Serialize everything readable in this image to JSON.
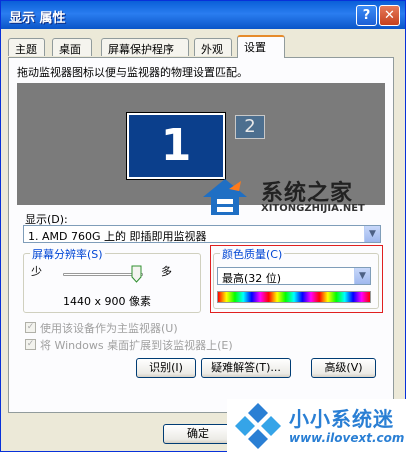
{
  "window": {
    "title": "显示 属性",
    "help_glyph": "?",
    "close_glyph": "✕"
  },
  "tabs": [
    {
      "label": "主题"
    },
    {
      "label": "桌面"
    },
    {
      "label": "屏幕保护程序"
    },
    {
      "label": "外观"
    },
    {
      "label": "设置",
      "active": true
    }
  ],
  "settings": {
    "instruction": "拖动监视器图标以便与监视器的物理设置匹配。",
    "monitor1": "1",
    "monitor2": "2",
    "display_label": "显示(D):",
    "display_value": "1. AMD 760G 上的 即插即用监视器",
    "resolution": {
      "title": "屏幕分辨率(S)",
      "less": "少",
      "more": "多",
      "value_text": "1440 x 900 像素",
      "slider_level_percent": 100
    },
    "color_quality": {
      "title": "颜色质量(C)",
      "value": "最高(32 位)"
    },
    "checkboxes": [
      {
        "label": "使用该设备作为主监视器(U)",
        "checked": true,
        "enabled": false
      },
      {
        "label": "将 Windows 桌面扩展到该监视器上(E)",
        "checked": true,
        "enabled": false
      }
    ],
    "buttons": {
      "identify": "识别(I)",
      "troubleshoot": "疑难解答(T)...",
      "advanced": "高级(V)"
    }
  },
  "ok_button": "确定",
  "watermarks": {
    "site1_name": "系统之家",
    "site1_domain": "XITONGZHIJIA.NET",
    "site2_name": "小小系统迷",
    "site2_url": "www.ilovext.com"
  },
  "colors": {
    "titlebar": "#0a5fd8",
    "window_bg": "#ece9d8",
    "monitor_area": "#7b7b7b",
    "monitor_blue": "#0b3f8c",
    "group_title": "#0046d5",
    "highlight_box": "#e02020",
    "watermark_blue": "#2a7fd4"
  }
}
